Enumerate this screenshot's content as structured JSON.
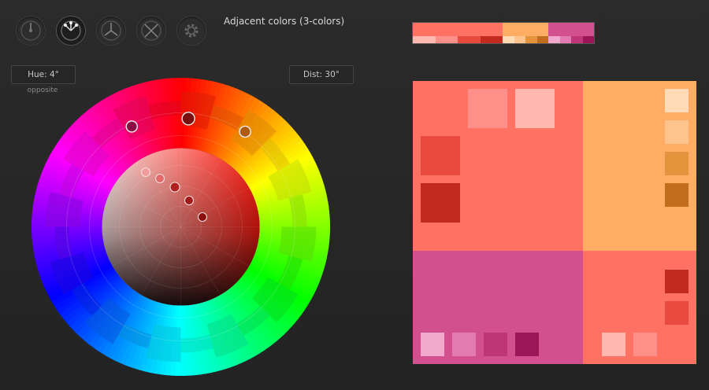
{
  "modes": [
    {
      "name": "mono-mode-button",
      "icon": "mono-scheme-icon",
      "active": false
    },
    {
      "name": "adjacent-mode-button",
      "icon": "adjacent-scheme-icon",
      "active": true
    },
    {
      "name": "triad-mode-button",
      "icon": "triad-scheme-icon",
      "active": false
    },
    {
      "name": "tetrad-mode-button",
      "icon": "tetrad-scheme-icon",
      "active": false
    },
    {
      "name": "settings-button",
      "icon": "gear-icon",
      "active": false
    }
  ],
  "scheme_title": "Adjacent colors (3-colors)",
  "hue_label": "Hue: 4°",
  "hue_note": "opposite",
  "dist_label": "Dist: 30°",
  "wheel": {
    "hue_degrees": 4,
    "distance_degrees": 30
  },
  "palette": [
    {
      "main": "#ff7163",
      "variants": [
        "#ffb8b0",
        "#ff9089",
        "#e84b3e",
        "#c22a1d"
      ]
    },
    {
      "main": "#ffac64",
      "variants": [
        "#ffdcb5",
        "#ffc48e",
        "#e6933e",
        "#c26c1d"
      ]
    },
    {
      "main": "#d3508e",
      "variants": [
        "#f0a8cc",
        "#e37bb0",
        "#bf3676",
        "#9a1656"
      ]
    }
  ],
  "colors": {
    "background": "#262626",
    "field_border": "#454545",
    "text": "#d8d8d8"
  }
}
